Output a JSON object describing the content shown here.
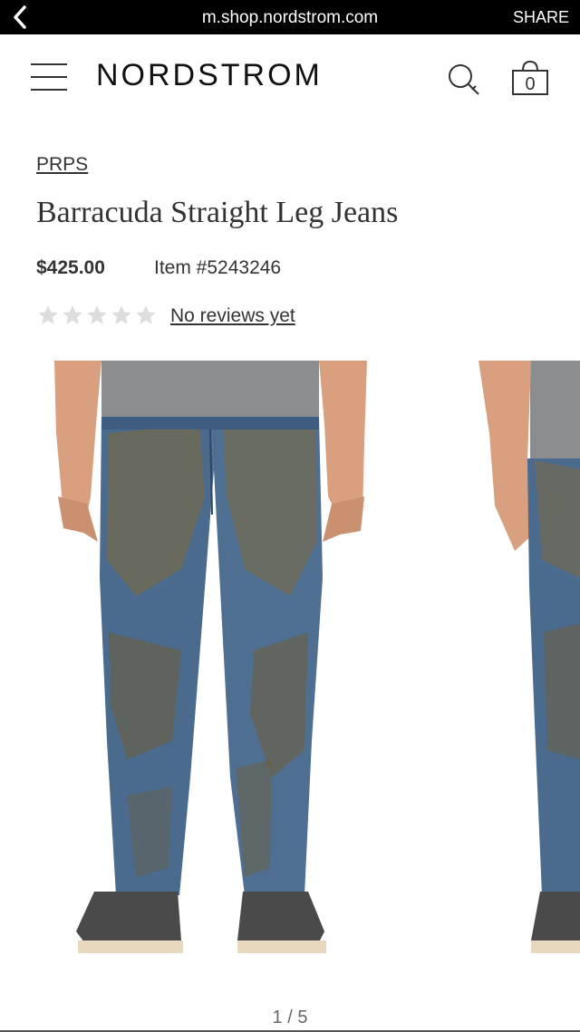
{
  "browser": {
    "url": "m.shop.nordstrom.com",
    "share_label": "SHARE"
  },
  "header": {
    "logo": "NORDSTROM",
    "cart_count": "0"
  },
  "product": {
    "brand": "PRPS",
    "title": "Barracuda Straight Leg Jeans",
    "price": "$425.00",
    "item_number": "Item #5243246",
    "rating": 0,
    "reviews_link": "No reviews yet"
  },
  "gallery": {
    "pager": "1 / 5"
  },
  "colors": {
    "denim": "#4a6a8e",
    "mud": "#7a6a45",
    "shirt": "#8a8c90"
  }
}
